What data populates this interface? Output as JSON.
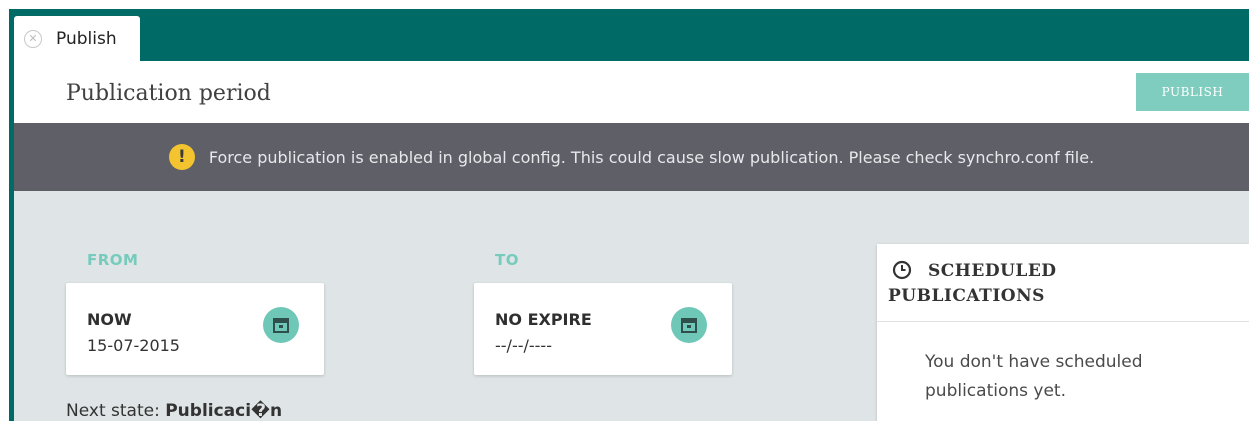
{
  "tab": {
    "label": "Publish",
    "close_icon": "close-circle-icon"
  },
  "header": {
    "title": "Publication period",
    "publish_label": "PUBLISH"
  },
  "warning": {
    "icon": "exclamation-icon",
    "text": "Force publication is enabled in global config. This could cause slow publication. Please check synchro.conf file."
  },
  "from": {
    "label": "FROM",
    "title": "NOW",
    "value": "15-07-2015",
    "icon": "calendar-icon"
  },
  "to": {
    "label": "TO",
    "title": "NO EXPIRE",
    "value": "--/--/----",
    "icon": "calendar-icon"
  },
  "next_state": {
    "label": "Next state:",
    "value": "Publicaci�n"
  },
  "scheduled": {
    "icon": "clock-icon",
    "title": "SCHEDULED PUBLICATIONS",
    "empty_text": "You don't have scheduled publications yet."
  },
  "colors": {
    "frame": "#006b66",
    "accent": "#76cbbd",
    "warning_bar": "#5e5f67",
    "warning_icon": "#f4c430",
    "content_bg": "#dfe5e6"
  }
}
